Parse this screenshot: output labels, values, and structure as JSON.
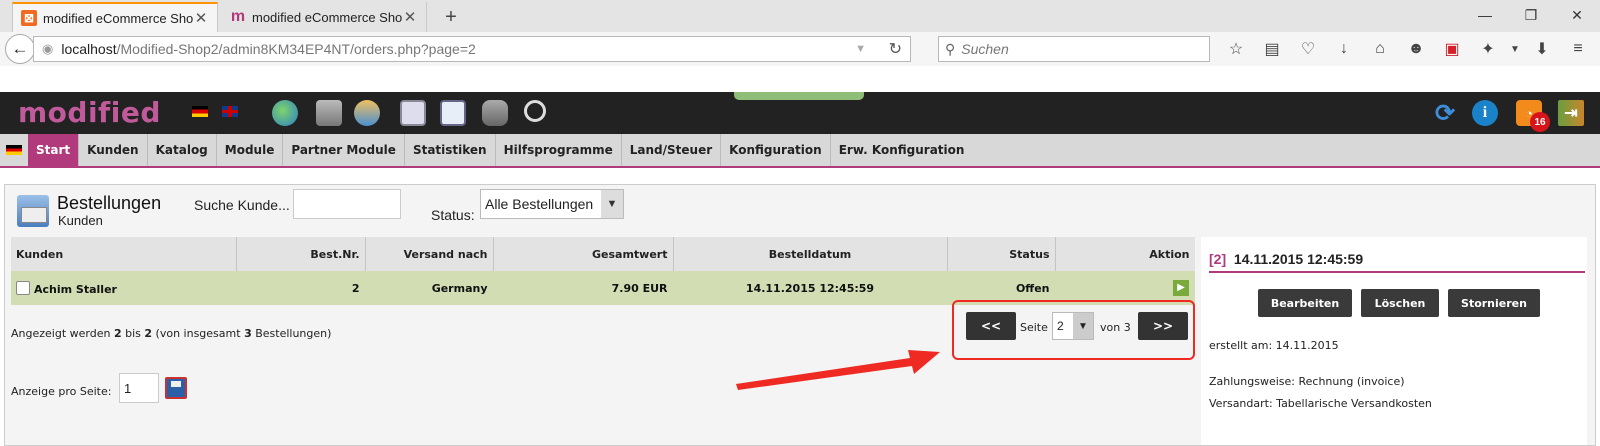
{
  "browser": {
    "tabs": [
      {
        "title": "modified eCommerce Sho...",
        "active": true
      },
      {
        "title": "modified eCommerce Sho...",
        "active": false
      }
    ],
    "url_host": "localhost",
    "url_path": "/Modified-Shop2/admin8KM34EP4NT/orders.php?page=2",
    "search_placeholder": "Suchen"
  },
  "header": {
    "logo": "modified",
    "notification_count": "16"
  },
  "menu": {
    "items": [
      "Start",
      "Kunden",
      "Katalog",
      "Module",
      "Partner Module",
      "Statistiken",
      "Hilfsprogramme",
      "Land/Steuer",
      "Konfiguration",
      "Erw. Konfiguration"
    ],
    "active": "Start"
  },
  "page": {
    "title": "Bestellungen",
    "subtitle": "Kunden",
    "search_label": "Suche Kunde...",
    "search_value": "",
    "status_label": "Status:",
    "status_value": "Alle Bestellungen"
  },
  "table": {
    "headers": {
      "customer": "Kunden",
      "order_no": "Best.Nr.",
      "ship_to": "Versand nach",
      "total": "Gesamtwert",
      "date": "Bestelldatum",
      "status": "Status",
      "action": "Aktion"
    },
    "rows": [
      {
        "customer": "Achim Staller",
        "order_no": "2",
        "ship_to": "Germany",
        "total": "7.90 EUR",
        "date": "14.11.2015 12:45:59",
        "status": "Offen"
      }
    ]
  },
  "footer": {
    "shown_prefix": "Angezeigt werden",
    "shown_from": "2",
    "shown_bis": "bis",
    "shown_to": "2",
    "shown_mid": "(von insgesamt",
    "shown_total": "3",
    "shown_suffix": "Bestellungen)",
    "per_page_label": "Anzeige pro Seite:",
    "per_page_value": "1"
  },
  "pagination": {
    "prev": "<<",
    "next": ">>",
    "page_label": "Seite",
    "current": "2",
    "of_label": "von 3"
  },
  "side": {
    "title_id": "[2]",
    "title_date": "14.11.2015 12:45:59",
    "buttons": {
      "edit": "Bearbeiten",
      "delete": "Löschen",
      "cancel": "Stornieren"
    },
    "created": "erstellt am: 14.11.2015",
    "payment": "Zahlungsweise: Rechnung (invoice)",
    "shipping": "Versandart: Tabellarische Versandkosten"
  },
  "colors": {
    "accent": "#b03a7c",
    "row_highlight": "#d2ddb3",
    "annotation_red": "#ee2a23"
  }
}
